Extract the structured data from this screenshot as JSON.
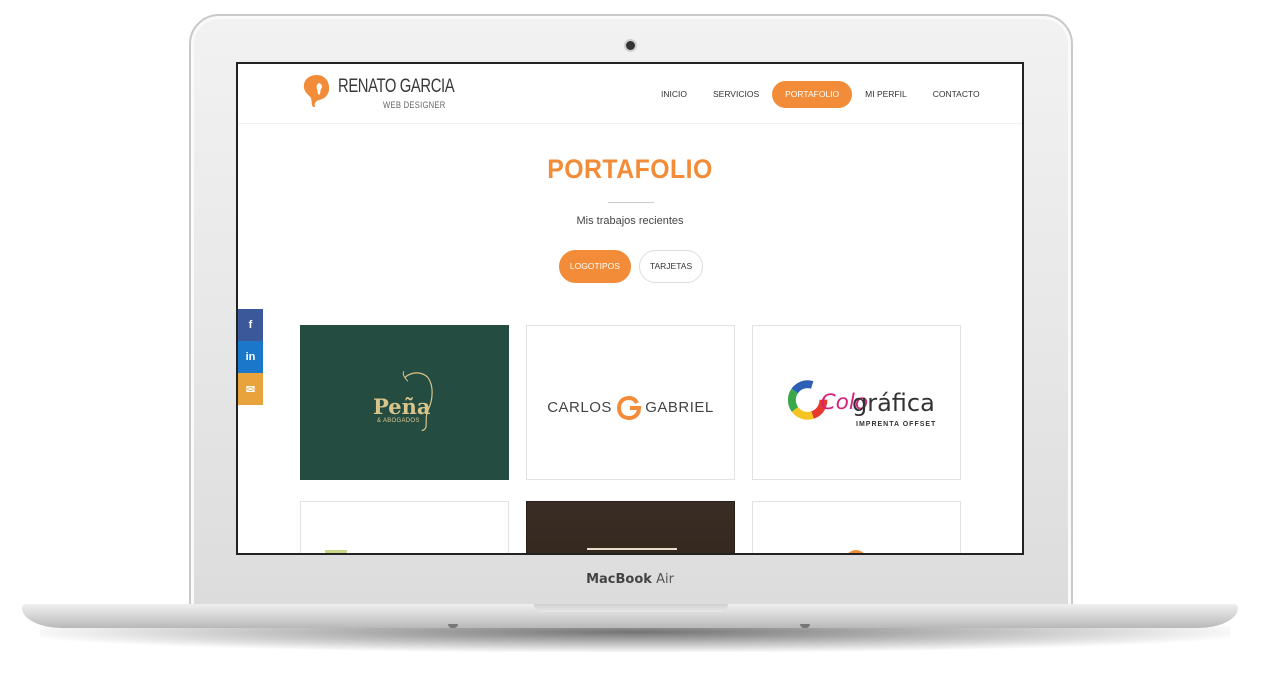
{
  "device": {
    "brand_bold": "MacBook",
    "brand_light": "Air"
  },
  "site": {
    "logo": {
      "name": "RENATO GARCIA",
      "tagline": "WEB DESIGNER",
      "icon": "head-silhouette-icon",
      "color": "#f28c38"
    },
    "nav": [
      {
        "label": "INICIO",
        "active": false
      },
      {
        "label": "SERVICIOS",
        "active": false
      },
      {
        "label": "PORTAFOLIO",
        "active": true
      },
      {
        "label": "MI PERFIL",
        "active": false
      },
      {
        "label": "CONTACTO",
        "active": false
      }
    ],
    "accent_color": "#f28c38"
  },
  "portfolio": {
    "title": "PORTAFOLIO",
    "subtitle": "Mis trabajos recientes",
    "filters": [
      {
        "label": "LOGOTIPOS",
        "active": true
      },
      {
        "label": "TARJETAS",
        "active": false
      }
    ],
    "items": [
      {
        "name": "Peña",
        "subtitle": "& ABOGADOS",
        "background": "#244c41"
      },
      {
        "name_left": "CARLOS",
        "name_right": "GABRIEL",
        "background": "#ffffff"
      },
      {
        "name_colored": "Colo",
        "name_plain": "gráfica",
        "subtitle": "IMPRENTA OFFSET",
        "background": "#ffffff"
      },
      {
        "background": "#ffffff"
      },
      {
        "background": "#2a1f18"
      },
      {
        "background": "#ffffff"
      }
    ]
  },
  "social": [
    {
      "icon": "facebook-icon",
      "glyph": "f",
      "color": "#3b5998"
    },
    {
      "icon": "linkedin-icon",
      "glyph": "in",
      "color": "#1a77c9"
    },
    {
      "icon": "mail-icon",
      "glyph": "✉",
      "color": "#e8a33c"
    }
  ]
}
